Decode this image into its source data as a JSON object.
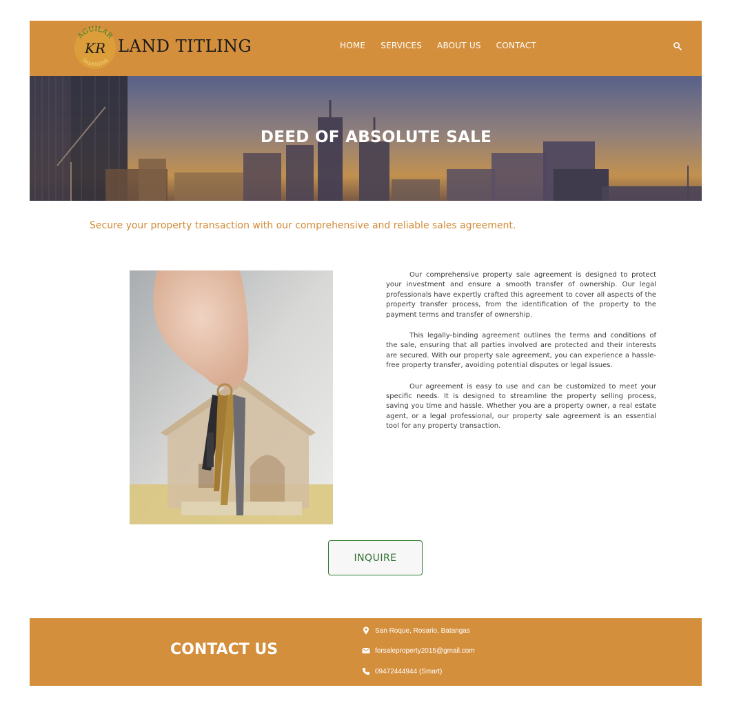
{
  "header": {
    "logo_text": "LAND TITLING",
    "logo_seal_top": "AGUILAR",
    "logo_seal_initials": "KR",
    "logo_seal_bottom": "landtitling",
    "nav": [
      "HOME",
      "SERVICES",
      "ABOUT US",
      "CONTACT"
    ],
    "search_icon": "search-icon"
  },
  "hero": {
    "title": "DEED OF ABSOLUTE SALE"
  },
  "tagline": "Secure your property transaction with our comprehensive and reliable sales agreement.",
  "body": {
    "paragraphs": [
      "Our comprehensive property sale agreement is designed to protect your investment and ensure a smooth transfer of ownership. Our legal professionals have expertly crafted this agreement to cover all aspects of the property transfer process, from the identification of the property to the payment terms and transfer of ownership.",
      "This legally-binding agreement outlines the terms and conditions of the sale, ensuring that all parties involved are protected and their interests are secured. With our property sale agreement, you can experience a hassle-free property transfer, avoiding potential disputes or legal issues.",
      "Our agreement is easy to use and can be customized to meet your specific needs. It is designed to streamline the property selling process, saving you time and hassle. Whether you are a property owner, a real estate agent, or a legal professional, our property sale agreement is an essential tool for any property transaction."
    ]
  },
  "inquire_label": "INQUIRE",
  "footer": {
    "title": "CONTACT US",
    "address": "San Roque, Rosario, Batangas",
    "email": "forsaleproperty2015@gmail.com",
    "phone": "09472444944 (Smart)"
  },
  "colors": {
    "brand": "#d48f3d",
    "accent_text": "#d18b35",
    "button_border": "#2f7a2f"
  }
}
